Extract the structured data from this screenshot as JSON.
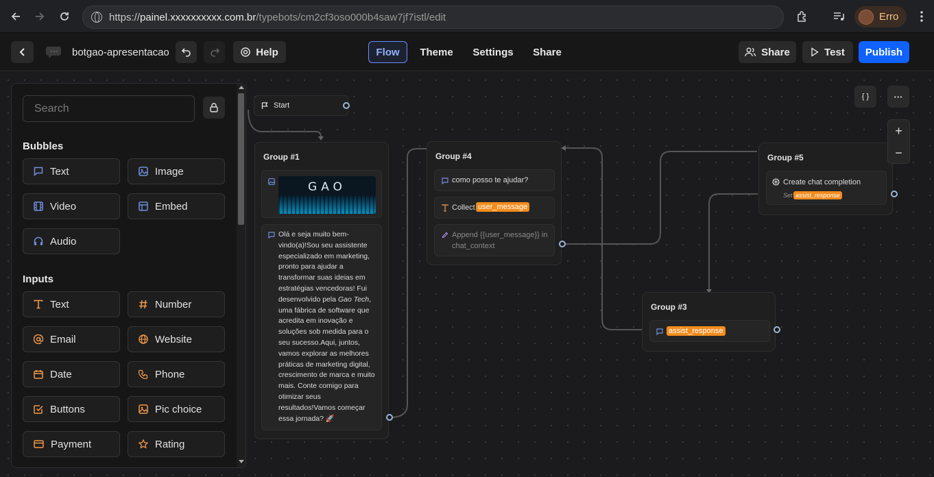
{
  "browser": {
    "url_prefix": "https://",
    "url_domain": "painel.xxxxxxxxxx.com.br",
    "url_path": "/typebots/cm2cf3oso000b4saw7jf7istl/edit",
    "profile_label": "Erro"
  },
  "editor": {
    "bot_name": "botgao-apresentacao",
    "help_label": "Help",
    "tabs": [
      "Flow",
      "Theme",
      "Settings",
      "Share"
    ],
    "active_tab": "Flow",
    "share_label": "Share",
    "test_label": "Test",
    "publish_label": "Publish"
  },
  "sidebar": {
    "search_placeholder": "Search",
    "bubbles_title": "Bubbles",
    "bubbles": [
      {
        "label": "Text",
        "icon": "chat-bubble-icon"
      },
      {
        "label": "Image",
        "icon": "image-icon"
      },
      {
        "label": "Video",
        "icon": "film-icon"
      },
      {
        "label": "Embed",
        "icon": "layout-icon"
      },
      {
        "label": "Audio",
        "icon": "headphones-icon"
      }
    ],
    "inputs_title": "Inputs",
    "inputs": [
      {
        "label": "Text",
        "icon": "text-t-icon"
      },
      {
        "label": "Number",
        "icon": "hash-icon"
      },
      {
        "label": "Email",
        "icon": "at-icon"
      },
      {
        "label": "Website",
        "icon": "globe-icon"
      },
      {
        "label": "Date",
        "icon": "calendar-icon"
      },
      {
        "label": "Phone",
        "icon": "phone-icon"
      },
      {
        "label": "Buttons",
        "icon": "checkbox-icon"
      },
      {
        "label": "Pic choice",
        "icon": "image-icon"
      },
      {
        "label": "Payment",
        "icon": "credit-card-icon"
      },
      {
        "label": "Rating",
        "icon": "star-icon"
      }
    ]
  },
  "flow": {
    "start_label": "Start",
    "group1": {
      "title": "Group #1",
      "logo_text": "GAO",
      "message": "Olá e seja muito bem-vindo(a)!Sou seu assistente especializado em marketing, pronto para ajudar a transformar suas ideias em estratégias vencedoras! Fui desenvolvido pela ",
      "message_em": "Gao Tech",
      "message_tail": ", uma fábrica de software que acredita em inovação e soluções sob medida para o seu sucesso.Aqui, juntos, vamos explorar as melhores práticas de marketing digital, crescimento de marca e muito mais. Conte comigo para otimizar seus resultados!Vamos começar essa jornada? 🚀"
    },
    "group4": {
      "title": "Group #4",
      "bubble_text": "como posso te ajudar?",
      "collect_label": "Collect",
      "collect_var": "user_message",
      "append_text": "Append {{user_message}} in chat_context"
    },
    "group5": {
      "title": "Group #5",
      "action_label": "Create chat completion",
      "set_label": "Set",
      "set_var": "assist_response"
    },
    "group3": {
      "title": "Group #3",
      "bubble_var": "assist_response"
    },
    "controls": {
      "variables_label": "{ }",
      "more_label": "···",
      "zoom_in": "+",
      "zoom_out": "−"
    }
  },
  "colors": {
    "accent": "#0f62fe",
    "variable_tag": "#f28c1e",
    "port_ring": "#9fb4d6",
    "icon_blue": "#6f8fe0",
    "icon_orange": "#f2994a"
  }
}
